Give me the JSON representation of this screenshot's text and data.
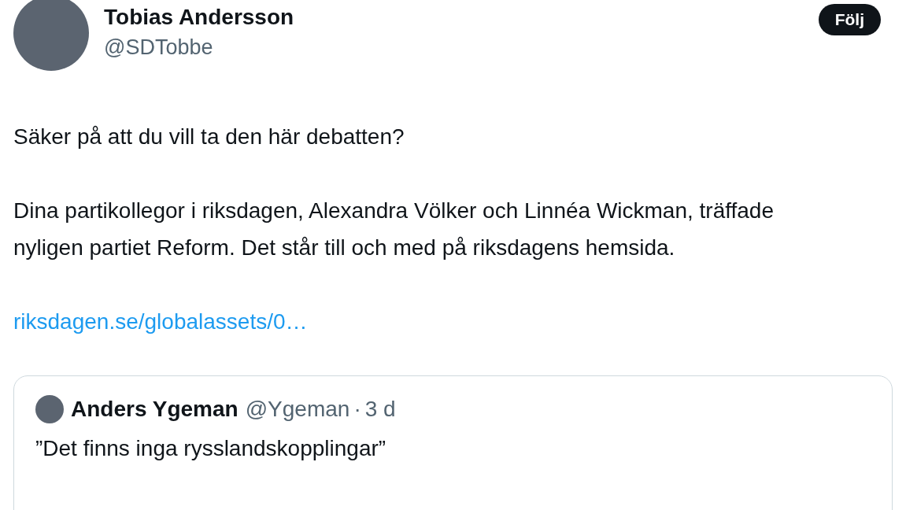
{
  "author": {
    "name": "Tobias Andersson",
    "handle": "@SDTobbe"
  },
  "follow_button": "Följ",
  "paragraphs": [
    "Säker på att du vill ta den här debatten?",
    "Dina partikollegor i riksdagen, Alexandra Völker och Linnéa Wickman, träffade nyligen partiet Reform. Det står till och med på riksdagens hemsida."
  ],
  "link": "riksdagen.se/globalassets/0…",
  "quote": {
    "name": "Anders Ygeman",
    "handle": "@Ygeman",
    "separator": "·",
    "time": "3 d",
    "text": "”Det finns inga rysslandskopplingar”"
  }
}
